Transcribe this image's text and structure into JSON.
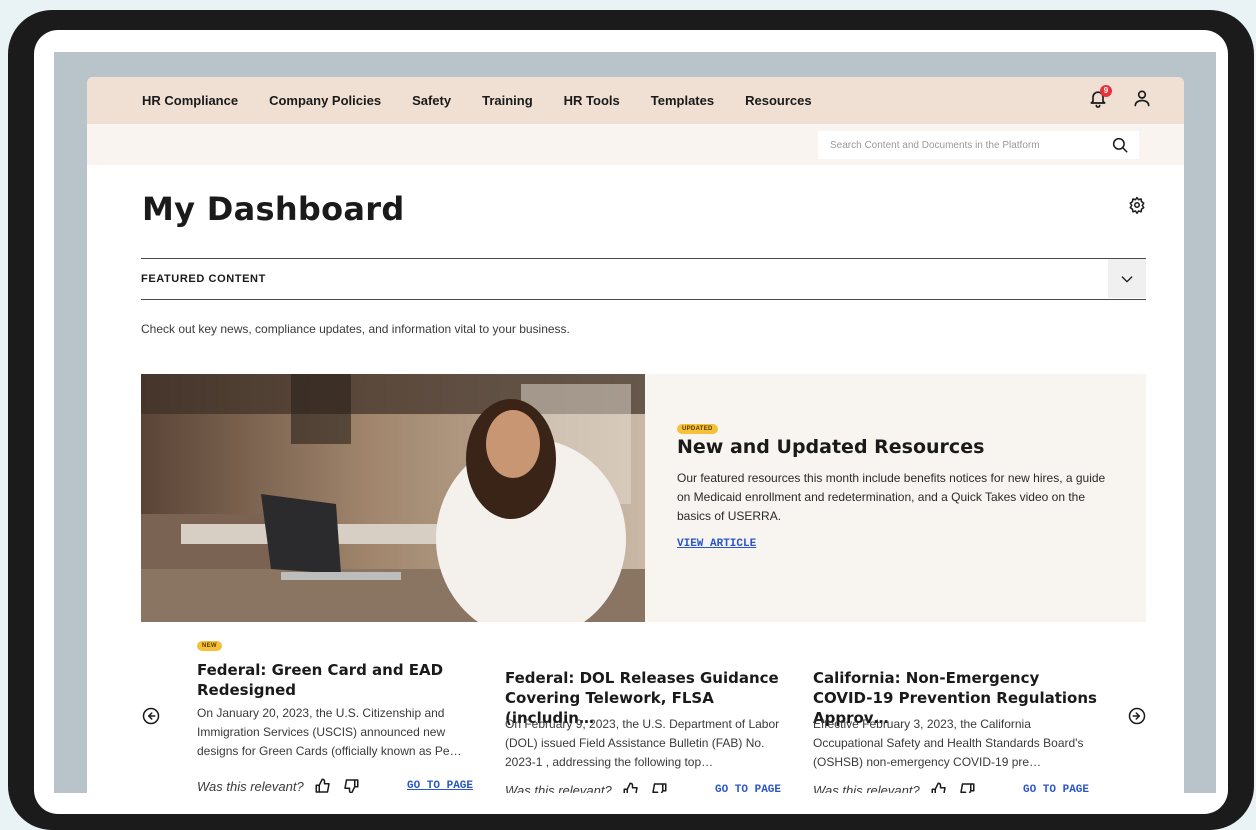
{
  "nav": {
    "items": [
      {
        "label": "HR Compliance"
      },
      {
        "label": "Company Policies"
      },
      {
        "label": "Safety"
      },
      {
        "label": "Training"
      },
      {
        "label": "HR Tools"
      },
      {
        "label": "Templates"
      },
      {
        "label": "Resources"
      }
    ],
    "notification_count": "9",
    "icons": [
      "bell-icon",
      "user-icon"
    ]
  },
  "search": {
    "placeholder": "Search Content and Documents in the Platform"
  },
  "page": {
    "title": "My Dashboard"
  },
  "featured": {
    "label": "FEATURED CONTENT",
    "intro": "Check out key news, compliance updates, and information vital to your business."
  },
  "hero": {
    "badge": "UPDATED",
    "title": "New and Updated Resources",
    "body": "Our featured resources this month include benefits notices for new hires, a guide on Medicaid enrollment and redetermination, and a Quick Takes video on the basics of USERRA.",
    "link": "VIEW ARTICLE"
  },
  "cards": [
    {
      "badge": "NEW",
      "title": "Federal: Green Card and EAD Redesigned",
      "body": "On January 20, 2023, the U.S. Citizenship and Immigration Services (USCIS) announced new designs for Green Cards (officially known as Pe…",
      "relevant": "Was this relevant?",
      "link": "GO TO PAGE"
    },
    {
      "title": "Federal: DOL Releases Guidance Covering Telework, FLSA (includin…",
      "body": "On February 9, 2023, the U.S. Department of Labor (DOL) issued Field Assistance Bulletin (FAB) No. 2023-1 , addressing the following top…",
      "relevant": "Was this relevant?",
      "link": "GO TO PAGE"
    },
    {
      "title": "California: Non-Emergency COVID-19 Prevention Regulations Approv…",
      "body": "Effective February 3, 2023, the California Occupational Safety and Health Standards Board's (OSHSB) non-emergency COVID-19 pre…",
      "relevant": "Was this relevant?",
      "link": "GO TO PAGE"
    }
  ],
  "colors": {
    "nav_bg": "#f0e0d3",
    "search_bg": "#f9f4ef",
    "hero_card_bg": "#f8f4ef",
    "badge": "#f5c13a",
    "link": "#2a55c9",
    "notification": "#e8323a"
  }
}
